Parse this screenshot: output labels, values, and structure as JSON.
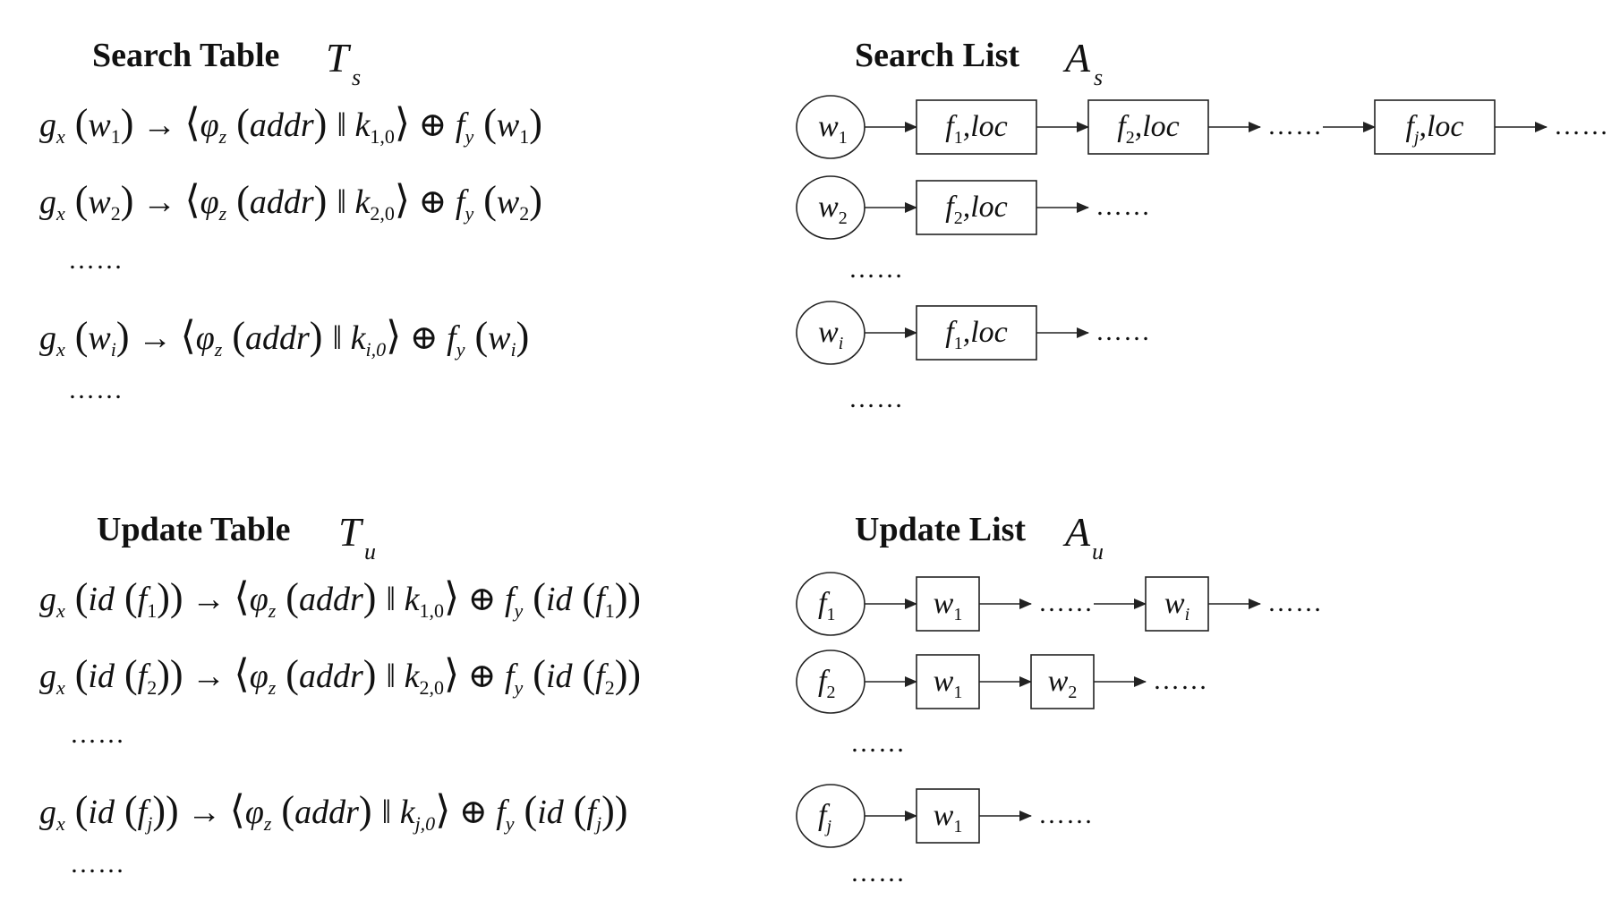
{
  "search_table": {
    "title": "Search Table",
    "symbol": "T",
    "symbol_sub": "s",
    "rows": [
      {
        "key_sub": "1",
        "k_sub": "1,0"
      },
      {
        "key_sub": "2",
        "k_sub": "2,0"
      },
      {
        "ellipsis": "……"
      },
      {
        "key_sub": "i",
        "k_sub": "i,0"
      },
      {
        "ellipsis": "……"
      }
    ]
  },
  "update_table": {
    "title": "Update Table",
    "symbol": "T",
    "symbol_sub": "u",
    "rows": [
      {
        "key_sub": "1",
        "k_sub": "1,0"
      },
      {
        "key_sub": "2",
        "k_sub": "2,0"
      },
      {
        "ellipsis": "……"
      },
      {
        "key_sub": "j",
        "k_sub": "j,0"
      },
      {
        "ellipsis": "……"
      }
    ]
  },
  "formula": {
    "g": "g",
    "g_sub": "x",
    "w": "w",
    "f": "f",
    "id": "id",
    "arrow": "→",
    "lang": "⟨",
    "rang": "⟩",
    "phi": "φ",
    "phi_sub": "z",
    "addr": "addr",
    "concat": "‖",
    "k": "k",
    "xor": "⊕",
    "fy": "f",
    "fy_sub": "y",
    "lp": "(",
    "rp": ")"
  },
  "search_list": {
    "title": "Search List",
    "symbol": "A",
    "symbol_sub": "s",
    "rows": [
      {
        "head": "w",
        "head_sub": "1",
        "items": [
          {
            "type": "box",
            "name": "f",
            "sub": "1",
            "suffix": ",loc"
          },
          {
            "type": "box",
            "name": "f",
            "sub": "2",
            "suffix": ",loc"
          },
          {
            "type": "dots",
            "text": "……"
          },
          {
            "type": "box",
            "name": "f",
            "sub": "j",
            "suffix": ",loc"
          },
          {
            "type": "dots",
            "text": "……"
          }
        ]
      },
      {
        "head": "w",
        "head_sub": "2",
        "items": [
          {
            "type": "box",
            "name": "f",
            "sub": "2",
            "suffix": ",loc"
          },
          {
            "type": "dots",
            "text": "……"
          }
        ]
      },
      {
        "ellipsis": "……"
      },
      {
        "head": "w",
        "head_sub": "i",
        "items": [
          {
            "type": "box",
            "name": "f",
            "sub": "1",
            "suffix": ",loc"
          },
          {
            "type": "dots",
            "text": "……"
          }
        ]
      },
      {
        "ellipsis": "……"
      }
    ]
  },
  "update_list": {
    "title": "Update List",
    "symbol": "A",
    "symbol_sub": "u",
    "rows": [
      {
        "head": "f",
        "head_sub": "1",
        "items": [
          {
            "type": "box",
            "name": "w",
            "sub": "1"
          },
          {
            "type": "dots",
            "text": "……"
          },
          {
            "type": "box",
            "name": "w",
            "sub": "i"
          },
          {
            "type": "dots",
            "text": "……"
          }
        ]
      },
      {
        "head": "f",
        "head_sub": "2",
        "items": [
          {
            "type": "box",
            "name": "w",
            "sub": "1"
          },
          {
            "type": "box",
            "name": "w",
            "sub": "2"
          },
          {
            "type": "dots",
            "text": "……"
          }
        ]
      },
      {
        "ellipsis": "……"
      },
      {
        "head": "f",
        "head_sub": "j",
        "items": [
          {
            "type": "box",
            "name": "w",
            "sub": "1"
          },
          {
            "type": "dots",
            "text": "……"
          }
        ]
      },
      {
        "ellipsis": "……"
      }
    ]
  }
}
